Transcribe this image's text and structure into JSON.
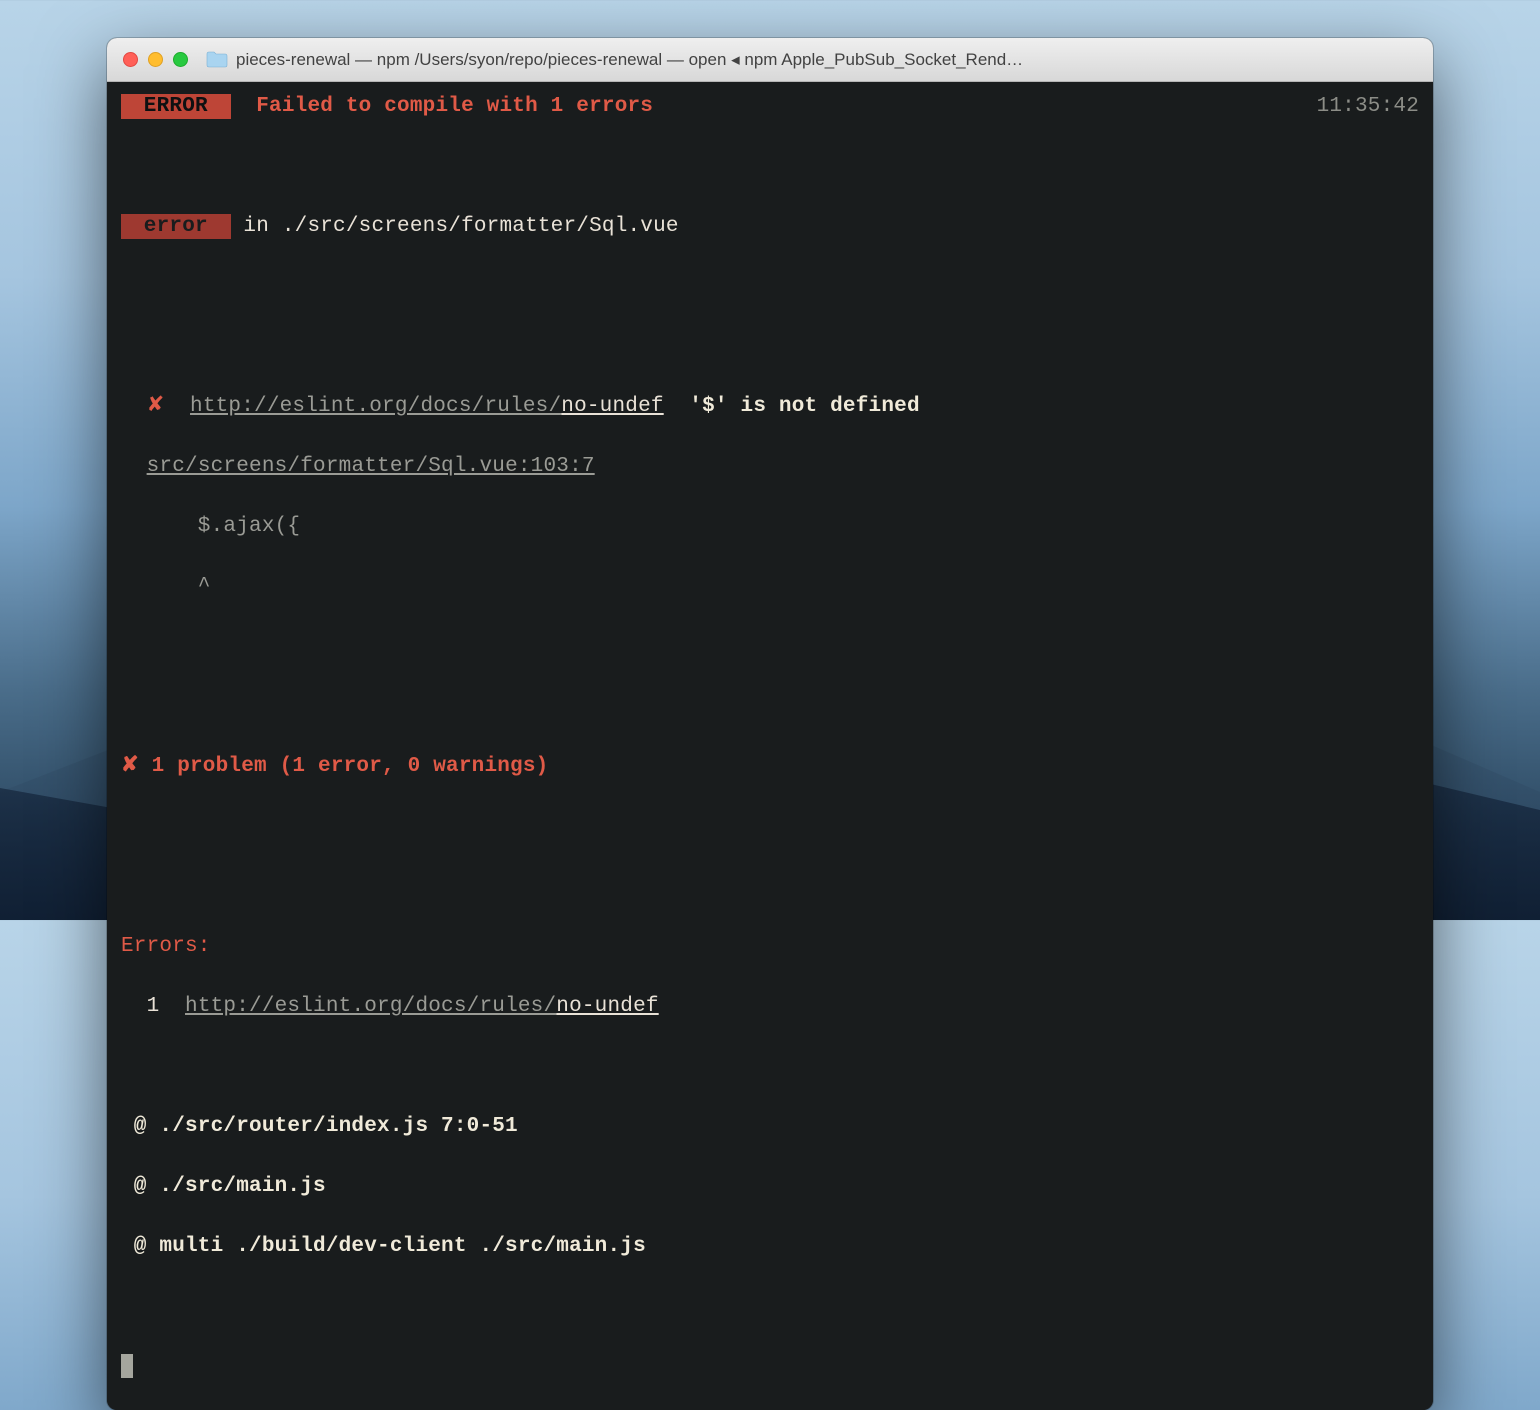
{
  "titlebar": {
    "text": "pieces-renewal — npm  /Users/syon/repo/pieces-renewal — open ◂ npm Apple_PubSub_Socket_Rend…"
  },
  "terminal": {
    "timestamp": "11:35:42",
    "error_badge_caps": " ERROR ",
    "error_badge_lower": " error ",
    "compile_msg": "Failed to compile with 1 errors",
    "in_word": " in ",
    "error_file": "./src/screens/formatter/Sql.vue",
    "cross_mark": "✘",
    "eslint_url_prefix": "http://eslint.org/docs/rules/",
    "eslint_rule": "no-undef",
    "lint_msg": "  '$' is not defined",
    "file_loc": "src/screens/formatter/Sql.vue:103:7",
    "code_line": "      $.ajax({",
    "caret_line": "      ^",
    "problem_line": " 1 problem (1 error, 0 warnings)",
    "errors_header": "Errors:",
    "errors_count": "  1  ",
    "stack1": " @ ./src/router/index.js 7:0-51",
    "stack2": " @ ./src/main.js",
    "stack3": " @ multi ./build/dev-client ./src/main.js"
  }
}
